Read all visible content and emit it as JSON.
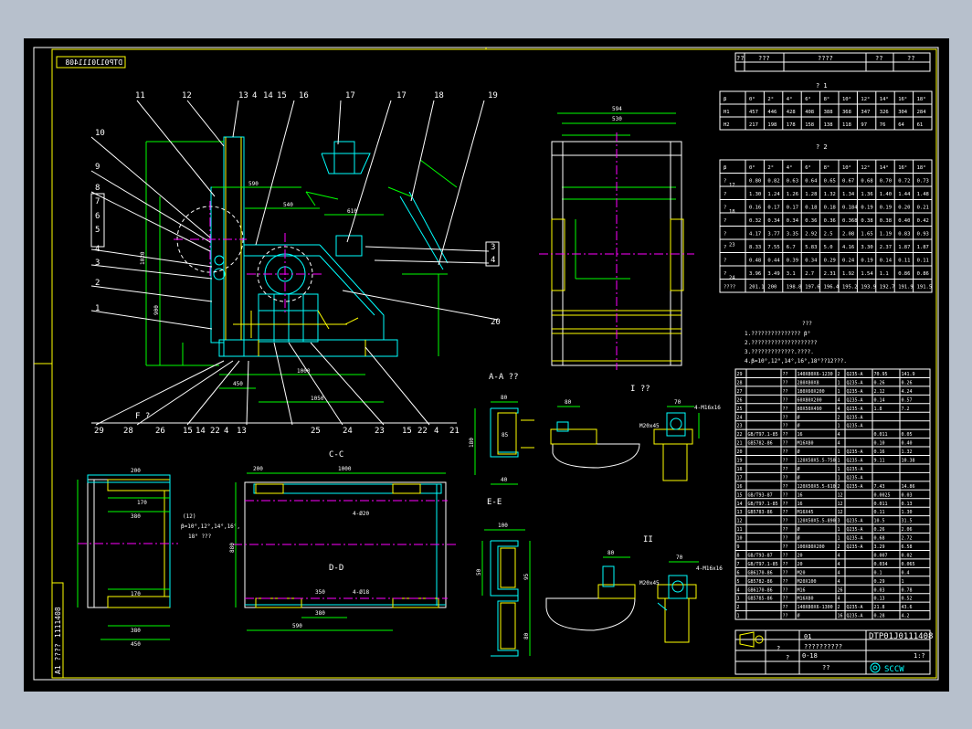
{
  "title_block": {
    "drawing_number": "DTP01J0111408",
    "mirrored_number": "DTP01J0111408",
    "side_number": "1111408",
    "side_label": "A1 ????",
    "header_cols": [
      "??",
      "???",
      "????",
      "??",
      "??"
    ],
    "bottom_row": [
      "??",
      "01",
      "??????????",
      "?",
      "?"
    ],
    "logo_text": "SCCW",
    "scale_label": "1:?",
    "weight_label": "0-18"
  },
  "part_callouts": [
    "11",
    "12",
    "13",
    "4",
    "14",
    "15",
    "16",
    "17",
    "17",
    "18",
    "19",
    "10",
    "9",
    "8",
    "7",
    "6",
    "5",
    "4",
    "3",
    "2",
    "1",
    "3",
    "4",
    "20",
    "29",
    "28",
    "26",
    "15",
    "14",
    "22",
    "4",
    "13",
    "25",
    "24",
    "23",
    "15",
    "22",
    "4",
    "21"
  ],
  "view_labels": {
    "aa": "A-A ??",
    "cc": "C-C",
    "dd": "D-D",
    "ee": "E-E",
    "f": "F ?",
    "detail1": "I ??",
    "detail2": "II"
  },
  "dims": {
    "front_top": [
      "590",
      "540",
      "610"
    ],
    "front_left": [
      "1020",
      "900"
    ],
    "front_bottom": [
      "1000",
      "1050",
      "450"
    ],
    "side_top": [
      "594",
      "530"
    ],
    "cc_top": [
      "1000",
      "200",
      "4-Ø20"
    ],
    "cc_left": [
      "880"
    ],
    "cc_bottom": [
      "380",
      "590",
      "350",
      "4-Ø18"
    ],
    "f_dims": [
      "200",
      "170",
      "380",
      "170",
      "380",
      "450"
    ],
    "f_note": [
      "(12)",
      "β=10°,12°,14°,16°,",
      "18° ??? "
    ],
    "aa_dims": [
      "80",
      "180",
      "85",
      "40"
    ],
    "ee_dims": [
      "100",
      "95",
      "50",
      "80"
    ],
    "detail_dims": [
      "80",
      "70",
      "4-M16x16",
      "M20x45"
    ]
  },
  "table1": {
    "title": "? 1",
    "header": [
      "β",
      "0°",
      "2°",
      "4°",
      "6°",
      "8°",
      "10°",
      "12°",
      "14°",
      "16°",
      "18°"
    ],
    "rows": [
      [
        "H1",
        "457",
        "446",
        "428",
        "408",
        "388",
        "368",
        "347",
        "326",
        "304",
        "284"
      ],
      [
        "H2",
        "217",
        "198",
        "178",
        "158",
        "138",
        "118",
        "97",
        "76",
        "64",
        "61"
      ]
    ]
  },
  "table2": {
    "title": "? 2",
    "header": [
      "β",
      "0°",
      "2°",
      "4°",
      "6°",
      "8°",
      "10°",
      "12°",
      "14°",
      "16°",
      "18°"
    ],
    "rows": [
      [
        "?",
        "0.80",
        "0.82",
        "0.63",
        "0.64",
        "0.65",
        "0.67",
        "0.68",
        "0.70",
        "0.72",
        "0.73"
      ],
      [
        "?",
        "1.30",
        "1.24",
        "1.26",
        "1.28",
        "1.32",
        "1.34",
        "1.36",
        "1.40",
        "1.44",
        "1.48"
      ],
      [
        "?",
        "0.16",
        "0.17",
        "0.17",
        "0.18",
        "0.18",
        "0.184",
        "0.19",
        "0.19",
        "0.20",
        "0.21"
      ],
      [
        "?",
        "0.32",
        "0.34",
        "0.34",
        "0.36",
        "0.36",
        "0.368",
        "0.38",
        "0.38",
        "0.40",
        "0.42"
      ],
      [
        "?",
        "4.17",
        "3.77",
        "3.35",
        "2.92",
        "2.5",
        "2.08",
        "1.65",
        "1.19",
        "0.83",
        "0.93"
      ],
      [
        "?",
        "8.33",
        "7.55",
        "6.7",
        "5.83",
        "5.0",
        "4.16",
        "3.30",
        "2.37",
        "1.87",
        "1.87"
      ],
      [
        "?",
        "0.48",
        "0.44",
        "0.39",
        "0.34",
        "0.29",
        "0.24",
        "0.19",
        "0.14",
        "0.11",
        "0.11"
      ],
      [
        "?",
        "3.96",
        "3.49",
        "3.1",
        "2.7",
        "2.31",
        "1.92",
        "1.54",
        "1.1",
        "0.86",
        "0.86"
      ],
      [
        "????",
        "201.1",
        "200",
        "198.8",
        "197.6",
        "196.4",
        "195.2",
        "193.9",
        "192.7",
        "191.9",
        "191.5"
      ]
    ],
    "group_labels": [
      "17",
      "18",
      "23",
      "24"
    ]
  },
  "notes": {
    "title": "???",
    "lines": [
      "1.???????????????     β°",
      "2.????????????????????",
      "3.?????????????.????.",
      "4.β=10°,12°,14°,16°,18°??12???."
    ]
  },
  "bom": {
    "rows": [
      [
        "29",
        "",
        "??",
        "140X80X6-1230",
        "2",
        "Q235-A",
        "70.95",
        "141.9"
      ],
      [
        "28",
        "",
        "??",
        "280X80X8",
        "1",
        "Q235-A",
        "0.26",
        "0.26"
      ],
      [
        "27",
        "",
        "??",
        "180X60X200",
        "1",
        "Q235-A",
        "2.12",
        "4.24"
      ],
      [
        "26",
        "",
        "??",
        "60X80X200",
        "4",
        "Q235-A",
        "0.14",
        "0.57"
      ],
      [
        "25",
        "",
        "??",
        "80X50X490",
        "4",
        "Q235-A",
        "1.8",
        "7.2"
      ],
      [
        "24",
        "",
        "??",
        "Ø",
        "2",
        "Q235-A",
        "",
        ""
      ],
      [
        "23",
        "",
        "??",
        "Ø",
        "1",
        "Q235-A",
        "",
        ""
      ],
      [
        "22",
        "GB/T97.1-85",
        "??",
        "16",
        "4",
        "",
        "0.011",
        "0.05"
      ],
      [
        "21",
        "GB5782-86",
        "??",
        "M16X80",
        "4",
        "",
        "0.10",
        "0.40"
      ],
      [
        "20",
        "",
        "??",
        "Ø",
        "1",
        "Q235-A",
        "0.16",
        "1.32"
      ],
      [
        "19",
        "",
        "??",
        "120X50X5.5-750",
        "1",
        "Q235-A",
        "9.11",
        "10.38"
      ],
      [
        "18",
        "",
        "??",
        "Ø",
        "1",
        "Q235-A",
        "",
        ""
      ],
      [
        "17",
        "",
        "??",
        "Ø",
        "1",
        "Q235-A",
        "",
        ""
      ],
      [
        "16",
        "",
        "??",
        "120X50X5.5-610",
        "2",
        "Q235-A",
        "7.43",
        "14.86"
      ],
      [
        "15",
        "GB/T93-87",
        "??",
        "16",
        "12",
        "",
        "0.0025",
        "0.03"
      ],
      [
        "14",
        "GB/T97.1-85",
        "??",
        "16",
        "12",
        "",
        "0.011",
        "0.13"
      ],
      [
        "13",
        "GB5783-86",
        "??",
        "M16X45",
        "12",
        "",
        "0.11",
        "1.30"
      ],
      [
        "12",
        "",
        "??",
        "120X50X5.5-890",
        "3",
        "Q235-A",
        "10.5",
        "31.5"
      ],
      [
        "11",
        "",
        "??",
        "Ø",
        "1",
        "Q235-A",
        "0.26",
        "2.06"
      ],
      [
        "10",
        "",
        "??",
        "Ø",
        "1",
        "Q235-A",
        "0.68",
        "2.72"
      ],
      [
        "9",
        "",
        "??",
        "100X80X200",
        "2",
        "Q235-A",
        "3.29",
        "6.58"
      ],
      [
        "8",
        "GB/T93-87",
        "??",
        "20",
        "4",
        "",
        "0.007",
        "0.02"
      ],
      [
        "7",
        "GB/T97.1-85",
        "??",
        "20",
        "4",
        "",
        "0.034",
        "0.065"
      ],
      [
        "6",
        "GB6170-86",
        "??",
        "M20",
        "4",
        "",
        "0.1",
        "0.4"
      ],
      [
        "5",
        "GB5782-86",
        "??",
        "M20X100",
        "4",
        "",
        "0.29",
        "1"
      ],
      [
        "4",
        "GB6170-86",
        "??",
        "M16",
        "26",
        "",
        "0.03",
        "0.78"
      ],
      [
        "3",
        "GB5785-86",
        "??",
        "M16X80",
        "4",
        "",
        "0.13",
        "0.52"
      ],
      [
        "2",
        "",
        "??",
        "140X80X6-1300",
        "2",
        "Q235-A",
        "21.8",
        "43.6"
      ],
      [
        "1",
        "",
        "??",
        "Ø",
        "16",
        "Q235-A",
        "0.28",
        "4.2"
      ]
    ]
  }
}
